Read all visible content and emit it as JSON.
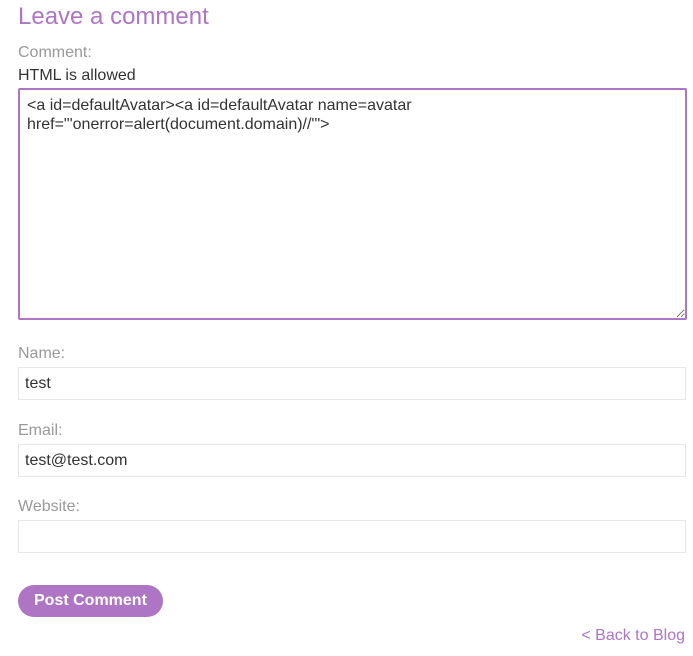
{
  "page_title": "Leave a comment",
  "form": {
    "comment_label": "Comment:",
    "comment_hint": "HTML is allowed",
    "comment_value": "<a id=defaultAvatar><a id=defaultAvatar name=avatar href=\"'onerror=alert(document.domain)//'\">",
    "name_label": "Name:",
    "name_value": "test",
    "email_label": "Email:",
    "email_value": "test@test.com",
    "website_label": "Website:",
    "website_value": "",
    "submit_label": "Post Comment"
  },
  "back_link": "< Back to Blog",
  "colors": {
    "accent": "#ae75c5",
    "label": "#999999",
    "text": "#333333",
    "border": "#e6e6e6"
  }
}
